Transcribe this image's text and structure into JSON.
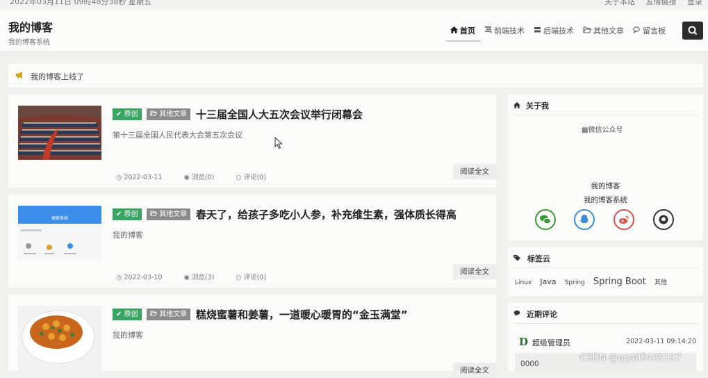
{
  "topbar": {
    "datetime": "2022年03月11日 09时48分38秒 星期五",
    "links": [
      "关于本站",
      "友情链接",
      "登录"
    ]
  },
  "header": {
    "site_title": "我的博客",
    "site_subtitle": "我的博客系统",
    "nav": [
      {
        "label": "首页",
        "icon": "home-icon",
        "active": true
      },
      {
        "label": "前端技术",
        "icon": "code-icon",
        "active": false
      },
      {
        "label": "后端技术",
        "icon": "server-icon",
        "active": false
      },
      {
        "label": "其他文章",
        "icon": "folder-open-icon",
        "active": false
      },
      {
        "label": "留言板",
        "icon": "comments-icon",
        "active": false
      }
    ],
    "search_icon": "search-icon"
  },
  "notice": {
    "icon": "bullhorn-icon",
    "text": "我的博客上线了"
  },
  "posts": [
    {
      "badge_original": "原创",
      "category": "其他文章",
      "title": "十三届全国人大五次会议举行闭幕会",
      "summary": "第十三届全国人民代表大会第五次会议",
      "date": "2022-03-11",
      "views": "浏览(0)",
      "comments": "评论(0)",
      "read_more": "阅读全文"
    },
    {
      "badge_original": "原创",
      "category": "其他文章",
      "title": "春天了，给孩子多吃小人参，补充维生素，强体质长得高",
      "summary": "我的博客",
      "date": "2022-03-10",
      "views": "浏览(3)",
      "comments": "评论(0)",
      "read_more": "阅读全文",
      "thumb_header": "搜索系统"
    },
    {
      "badge_original": "原创",
      "category": "其他文章",
      "title": "糕烧蜜薯和姜薯，一道暖心暖胃的“金玉满堂”",
      "summary": "我的博客",
      "read_more": "阅读全文"
    }
  ],
  "sidebar": {
    "about": {
      "title": "关于我",
      "wechat_img_alt": "微信公众号",
      "name": "我的博客",
      "desc": "我的博客系统",
      "social": [
        {
          "icon": "wechat-icon",
          "color": "#3a9a3a"
        },
        {
          "icon": "qq-icon",
          "color": "#3b8fd8"
        },
        {
          "icon": "weibo-icon",
          "color": "#d9534f"
        },
        {
          "icon": "github-icon",
          "color": "#333333"
        }
      ]
    },
    "tags": {
      "title": "标签云",
      "items": [
        "Linux",
        "Java",
        "Spring",
        "Spring Boot",
        "其他"
      ]
    },
    "recent_comments": {
      "title": "近期评论",
      "user": "超级管理员",
      "time": "2022-03-11 09:14:20",
      "text": "0000"
    }
  },
  "watermark": "CSDN @qq405425197"
}
